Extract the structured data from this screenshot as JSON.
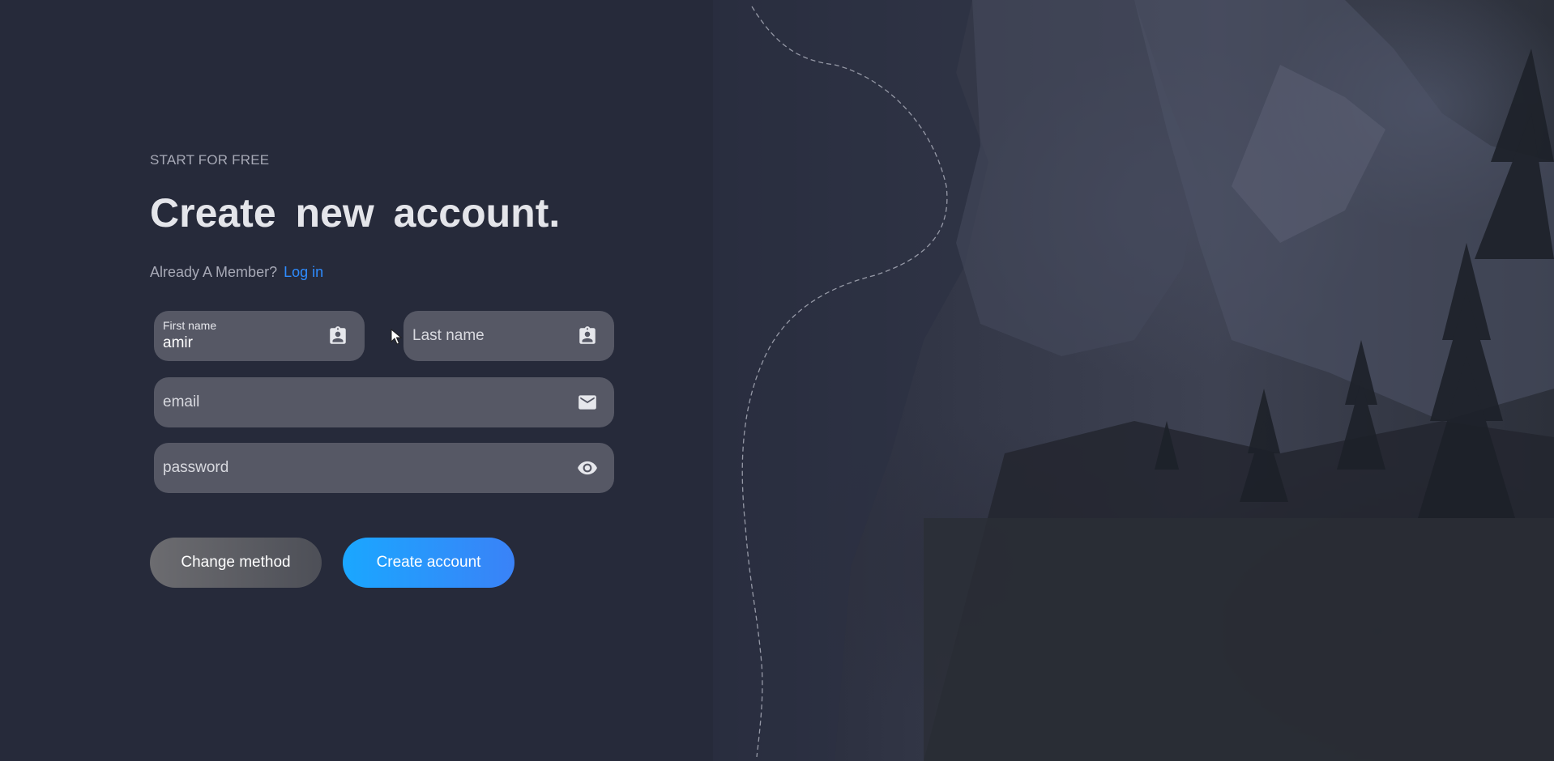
{
  "header": {
    "eyebrow": "START FOR FREE",
    "title": "Create new account.",
    "member_prompt": "Already A Member?",
    "login_link": "Log in"
  },
  "form": {
    "first_name": {
      "label": "First name",
      "value": "amir",
      "icon": "contact-card-icon"
    },
    "last_name": {
      "placeholder": "Last name",
      "icon": "contact-card-icon"
    },
    "email": {
      "placeholder": "email",
      "icon": "mail-icon"
    },
    "password": {
      "placeholder": "password",
      "icon": "eye-icon"
    }
  },
  "actions": {
    "change_method": "Change method",
    "create_account": "Create account"
  },
  "colors": {
    "background": "#262a3a",
    "field": "#565865",
    "link": "#2e8cff",
    "primary_button_start": "#1aa7ff",
    "primary_button_end": "#3a82f7",
    "secondary_button_start": "#6c6c70",
    "secondary_button_end": "#4d4f57"
  }
}
